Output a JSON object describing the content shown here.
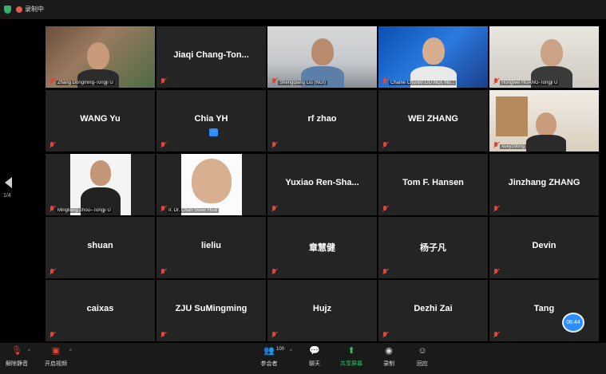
{
  "topbar": {
    "recording_label": "录制中"
  },
  "nav": {
    "page_indicator": "1/4"
  },
  "tiles": [
    {
      "name": "Zhang Dongming-Tongji U",
      "video": true
    },
    {
      "name": "Jiaqi  Chang-Ton...",
      "video": false
    },
    {
      "name": "Shengqiang Liu (NGI)",
      "video": true
    },
    {
      "name": "Charlie Chunlin LIU NGI, No...",
      "video": true,
      "active": true
    },
    {
      "name": "Hongwei HUANG-Tongji U",
      "video": true
    },
    {
      "name": "WANG Yu",
      "video": false
    },
    {
      "name": "Chia YH",
      "video": false
    },
    {
      "name": "rf zhao",
      "video": false
    },
    {
      "name": "WEI ZHANG",
      "video": false
    },
    {
      "name": "xueyzdong",
      "video": true
    },
    {
      "name": "Mingliang Zhou--Tongji U",
      "video": true
    },
    {
      "name": "Ir. Dr. Chan Swee Huat",
      "video": true
    },
    {
      "name": "Yuxiao  Ren-Sha...",
      "video": false
    },
    {
      "name": "Tom F. Hansen",
      "video": false
    },
    {
      "name": "Jinzhang ZHANG",
      "video": false
    },
    {
      "name": "shuan",
      "video": false
    },
    {
      "name": "lieliu",
      "video": false
    },
    {
      "name": "章慧健",
      "video": false
    },
    {
      "name": "杨子凡",
      "video": false
    },
    {
      "name": "Devin",
      "video": false
    },
    {
      "name": "caixas",
      "video": false
    },
    {
      "name": "ZJU SuMingming",
      "video": false
    },
    {
      "name": "Hujz",
      "video": false
    },
    {
      "name": "Dezhi Zai",
      "video": false
    },
    {
      "name": "Tang",
      "video": false
    }
  ],
  "timer": "06:44",
  "toolbar": {
    "unmute": "解除静音",
    "start_video": "开启视频",
    "participants": "参会者",
    "participant_count": "100",
    "chat": "聊天",
    "share_screen": "共享屏幕",
    "record": "录制",
    "reactions": "回应"
  },
  "colors": {
    "accent": "#2d8cff",
    "active_outline": "#c9d33a",
    "share_green": "#34c36a",
    "muted_red": "#e0463a"
  }
}
